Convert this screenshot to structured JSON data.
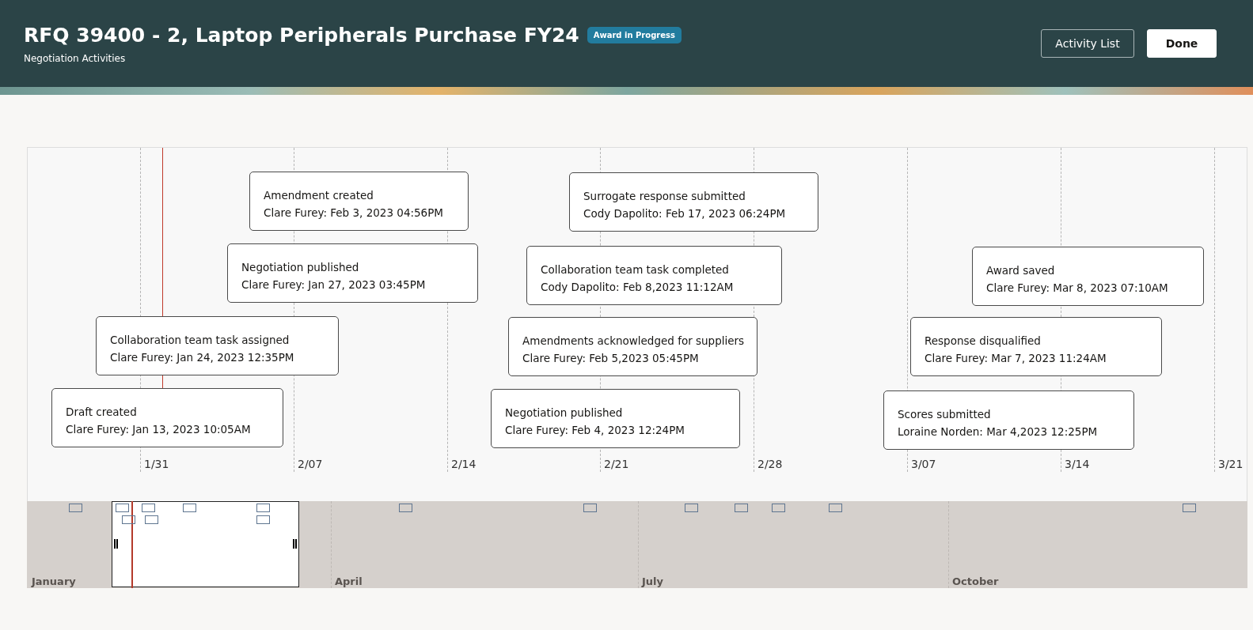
{
  "header": {
    "title": "RFQ 39400 - 2, Laptop Peripherals Purchase FY24",
    "status_badge": "Award in Progress",
    "subtitle": "Negotiation Activities",
    "buttons": [
      {
        "label": "Activity List",
        "kind": "secondary"
      },
      {
        "label": "Done",
        "kind": "primary"
      }
    ]
  },
  "timeline": {
    "axis_labels": [
      "1/31",
      "2/07",
      "2/14",
      "2/21",
      "2/28",
      "3/07",
      "3/14",
      "3/21"
    ],
    "events": [
      {
        "title": "Amendment created",
        "detail": "Clare Furey: Feb 3, 2023 04:56PM"
      },
      {
        "title": "Negotiation published",
        "detail": "Clare Furey: Jan 27, 2023 03:45PM"
      },
      {
        "title": "Collaboration team task assigned",
        "detail": "Clare Furey: Jan 24, 2023 12:35PM"
      },
      {
        "title": "Draft created",
        "detail": "Clare Furey: Jan 13, 2023 10:05AM"
      },
      {
        "title": "Surrogate response submitted",
        "detail": "Cody Dapolito:  Feb 17, 2023 06:24PM"
      },
      {
        "title": "Collaboration team task completed",
        "detail": "Cody Dapolito: Feb 8,2023 11:12AM"
      },
      {
        "title": "Amendments acknowledged for suppliers",
        "detail": "Clare Furey:  Feb 5,2023 05:45PM"
      },
      {
        "title": "Negotiation published",
        "detail": "Clare Furey: Feb 4, 2023 12:24PM"
      },
      {
        "title": "Award saved",
        "detail": "Clare Furey:  Mar 8, 2023 07:10AM"
      },
      {
        "title": "Response disqualified",
        "detail": "Clare Furey: Mar 7, 2023 11:24AM"
      },
      {
        "title": "Scores submitted",
        "detail": "Loraine Norden: Mar 4,2023 12:25PM"
      }
    ]
  },
  "overview": {
    "months": [
      "January",
      "April",
      "July",
      "October"
    ]
  }
}
